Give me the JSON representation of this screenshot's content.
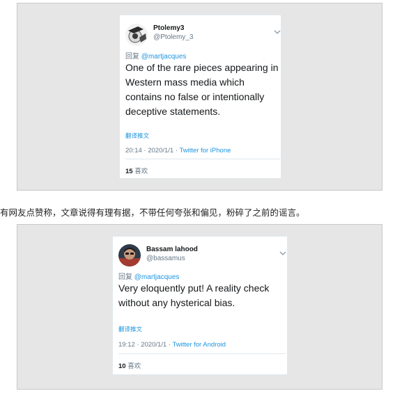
{
  "tweets": [
    {
      "display_name": "Ptolemy3",
      "handle": "@Ptolemy_3",
      "reply_prefix": "回复",
      "reply_to": "@martjacques",
      "text": "One of the rare pieces appearing in Western mass media which contains no false or intentionally deceptive statements.",
      "translate": "翻译推文",
      "time_date": "20:14 · 2020/1/1 · ",
      "source": "Twitter for iPhone",
      "like_count": "15",
      "like_label": "喜欢"
    },
    {
      "display_name": "Bassam lahood",
      "handle": "@bassamus",
      "reply_prefix": "回复",
      "reply_to": "@martjacques",
      "text": "Very eloquently put! A reality check without any hysterical bias.",
      "translate": "翻译推文",
      "time_date": "19:12 · 2020/1/1 · ",
      "source": "Twitter for Android",
      "like_count": "10",
      "like_label": "喜欢"
    }
  ],
  "caption": "有网友点赞称，文章说得有理有据，不带任何夸张和偏见，粉碎了之前的谣言。",
  "colors": {
    "link_blue": "#1b95e0",
    "secondary_gray": "#657786",
    "panel_bg": "#e6e6e6"
  }
}
